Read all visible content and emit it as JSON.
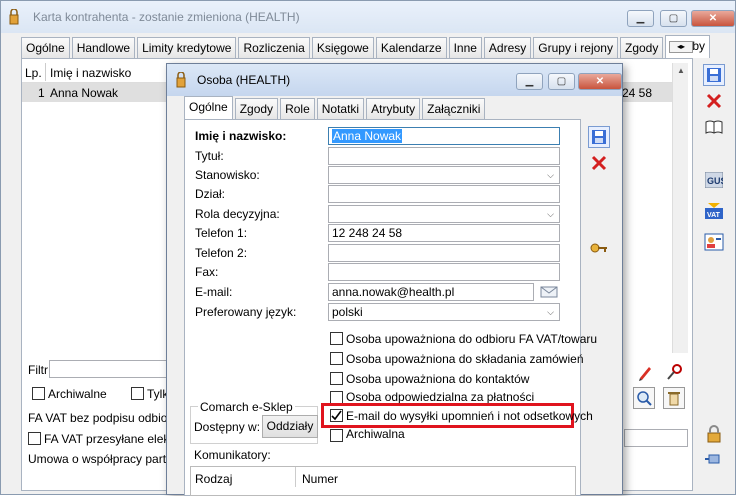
{
  "outer": {
    "title": "Karta kontrahenta - zostanie zmieniona (HEALTH)",
    "tabs": [
      "Ogólne",
      "Handlowe",
      "Limity kredytowe",
      "Rozliczenia",
      "Księgowe",
      "Kalendarze",
      "Inne",
      "Adresy",
      "Grupy i rejony",
      "Zgody",
      "Osoby"
    ],
    "active_tab": "Osoby",
    "table": {
      "headers": [
        "Lp.",
        "Imię i nazwisko"
      ],
      "rows": [
        {
          "lp": "1",
          "name": "Anna Nowak",
          "tail": "24 58"
        }
      ]
    },
    "filter_label": "Filtr:",
    "archiwalne_label": "Archiwalne",
    "tylko_label": "Tylk",
    "fa_vat_bez": "FA VAT bez podpisu odbiorcy",
    "fa_vat_przesylane": "FA VAT przesyłane elektr",
    "umowa": "Umowa o współpracy partner"
  },
  "dialog": {
    "title": "Osoba  (HEALTH)",
    "tabs": [
      "Ogólne",
      "Zgody",
      "Role",
      "Notatki",
      "Atrybuty",
      "Załączniki"
    ],
    "active_tab": "Ogólne",
    "fields": {
      "imie_label": "Imię i nazwisko:",
      "imie_value": "Anna Nowak",
      "tytul_label": "Tytuł:",
      "stanowisko_label": "Stanowisko:",
      "dzial_label": "Dział:",
      "rola_label": "Rola decyzyjna:",
      "telefon1_label": "Telefon 1:",
      "telefon1_value": "12 248 24 58",
      "telefon2_label": "Telefon 2:",
      "fax_label": "Fax:",
      "email_label": "E-mail:",
      "email_value": "anna.nowak@health.pl",
      "jezyk_label": "Preferowany język:",
      "jezyk_value": "polski"
    },
    "checkboxes": [
      {
        "label": "Osoba upoważniona do odbioru FA VAT/towaru",
        "checked": false
      },
      {
        "label": "Osoba upoważniona do składania zamówień",
        "checked": false
      },
      {
        "label": "Osoba upoważniona do kontaktów",
        "checked": false
      },
      {
        "label": "Osoba odpowiedzialna za płatności",
        "checked": false
      },
      {
        "label": "E-mail do wysyłki upomnień i not odsetkowych",
        "checked": true
      },
      {
        "label": "Archiwalna",
        "checked": false
      }
    ],
    "eshop": {
      "group_label": "Comarch e-Sklep",
      "dostepny_label": "Dostępny w:",
      "oddzialy_button": "Oddziały"
    },
    "komunikatory": {
      "label": "Komunikatory:",
      "headers": [
        "Rodzaj",
        "Numer"
      ]
    }
  },
  "colors": {
    "highlight_border": "#e0141e",
    "selection_blue": "#3399ff"
  }
}
